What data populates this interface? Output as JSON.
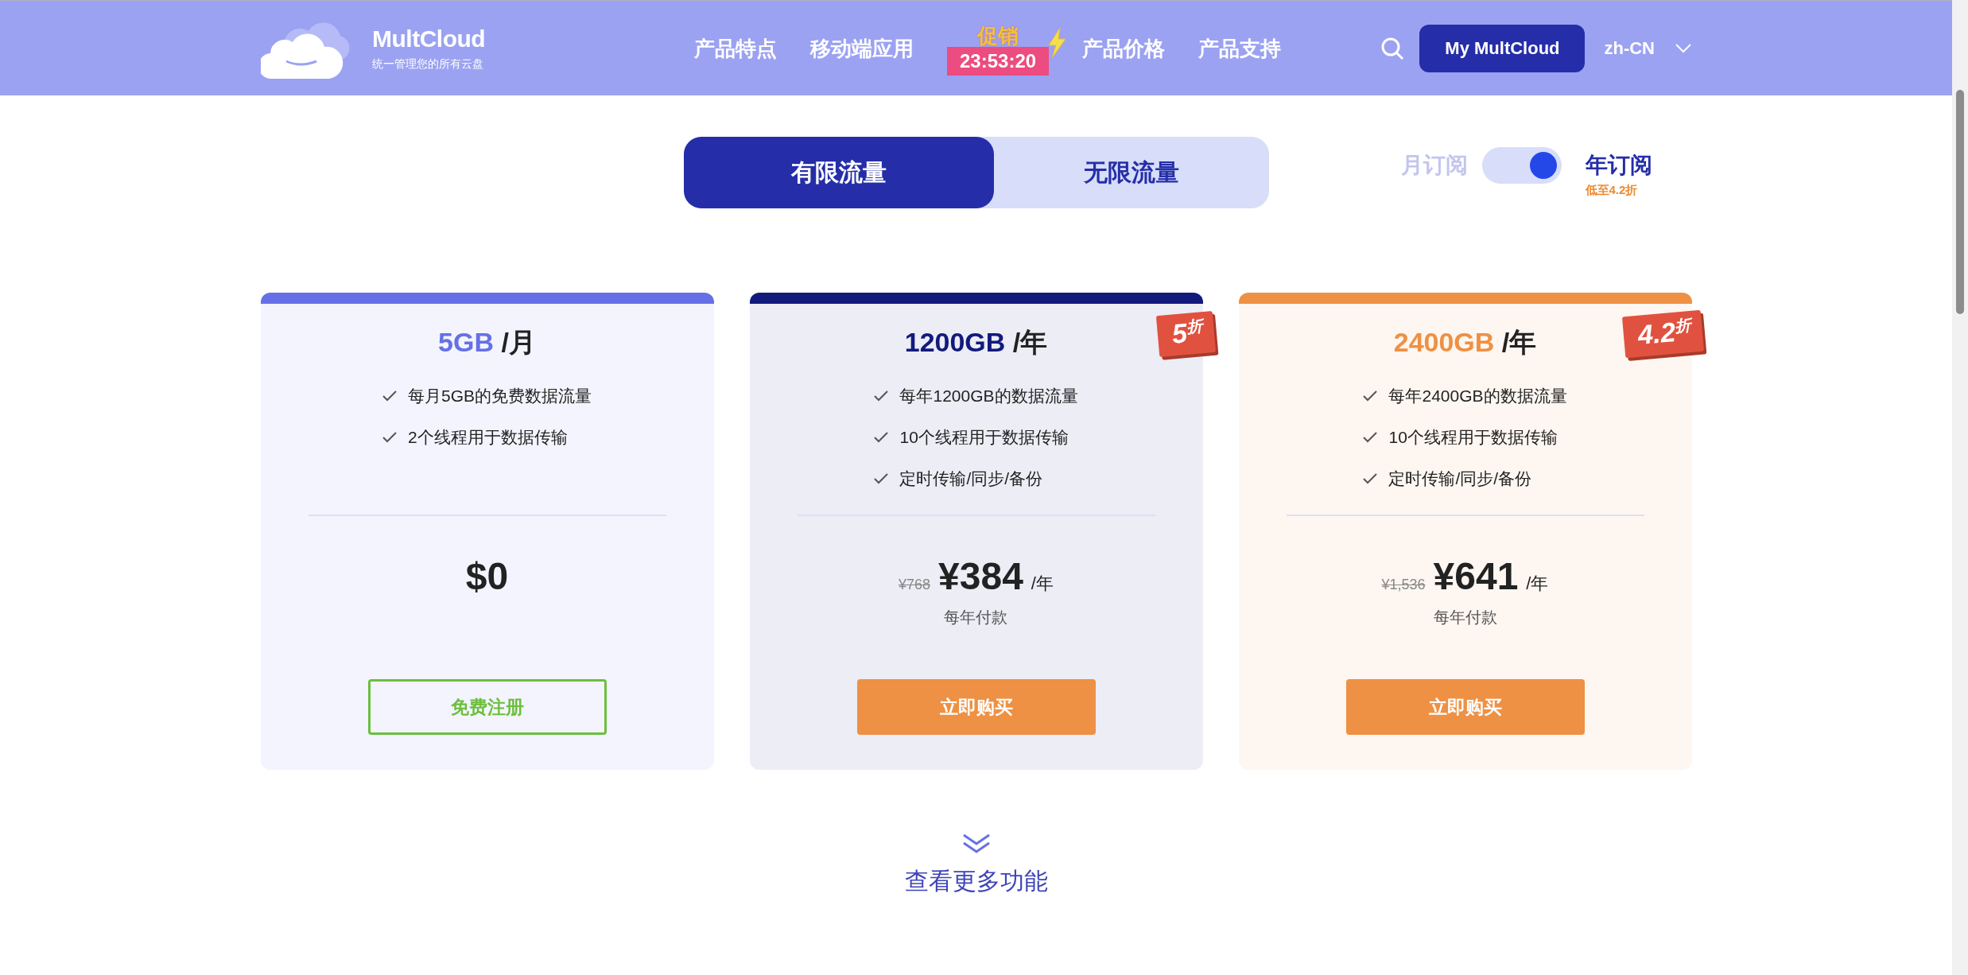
{
  "header": {
    "brand": "MultCloud",
    "tagline": "统一管理您的所有云盘",
    "nav": [
      {
        "label": "产品特点"
      },
      {
        "label": "移动端应用"
      },
      {
        "kind": "promo",
        "label": "促销",
        "timer": "23:53:20"
      },
      {
        "label": "产品价格"
      },
      {
        "label": "产品支持"
      }
    ],
    "account_button": "My MultCloud",
    "language": "zh-CN"
  },
  "plan_tabs": [
    {
      "label": "有限流量",
      "selected": true
    },
    {
      "label": "无限流量",
      "selected": false
    }
  ],
  "billing": {
    "options": [
      {
        "label": "月订阅",
        "selected": false
      },
      {
        "label": "年订阅",
        "selected": true,
        "note": "低至4.2折"
      }
    ]
  },
  "plans": [
    {
      "amount": "5GB",
      "period": "/月",
      "color": "#6670e6",
      "features": [
        "每月5GB的免费数据流量",
        "2个线程用于数据传输"
      ],
      "price": {
        "amount": "$0"
      },
      "button": {
        "label": "免费注册",
        "kind": "outline"
      }
    },
    {
      "amount": "1200GB",
      "period": "/年",
      "color": "#121a7c",
      "badge": "5$^{折}$",
      "features": [
        "每年1200GB的数据流量",
        "10个线程用于数据传输",
        "定时传输/同步/备份"
      ],
      "price": {
        "original": "¥768",
        "amount": "¥384",
        "unit": "/年"
      },
      "note": "每年付款",
      "button": {
        "label": "立即购买",
        "kind": "filled"
      }
    },
    {
      "amount": "2400GB",
      "period": "/年",
      "color": "#ee9144",
      "badge": "4.2$^{折}$",
      "features": [
        "每年2400GB的数据流量",
        "10个线程用于数据传输",
        "定时传输/同步/备份"
      ],
      "price": {
        "original": "¥1,536",
        "amount": "¥641",
        "unit": "/年"
      },
      "note": "每年付款",
      "button": {
        "label": "立即购买",
        "kind": "filled"
      }
    }
  ],
  "more": {
    "label": "查看更多功能"
  }
}
